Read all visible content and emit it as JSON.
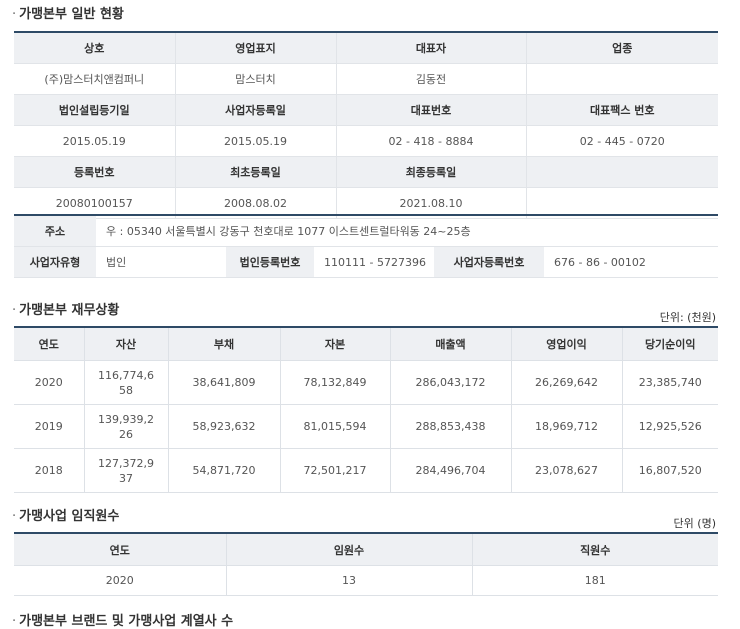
{
  "sec1": {
    "title": "가맹본부 일반 현황"
  },
  "general": {
    "row1_headers": [
      "상호",
      "영업표지",
      "대표자",
      "업종"
    ],
    "row1_values": [
      "(주)맘스터치앤컴퍼니",
      "맘스터치",
      "김동전",
      ""
    ],
    "row2_headers": [
      "법인설립등기일",
      "사업자등록일",
      "대표번호",
      "대표팩스 번호"
    ],
    "row2_values": [
      "2015.05.19",
      "2015.05.19",
      "02 - 418 - 8884",
      "02 - 445 - 0720"
    ],
    "row3_headers": [
      "등록번호",
      "최초등록일",
      "최종등록일",
      ""
    ],
    "row3_values": [
      "20080100157",
      "2008.08.02",
      "2021.08.10",
      ""
    ]
  },
  "address": {
    "label": "주소",
    "value": "우 : 05340 서울특별시 강동구 천호대로 1077 이스트센트럴타워동 24~25층",
    "biz_type_label": "사업자유형",
    "biz_type_value": "법인",
    "corp_reg_label": "법인등록번호",
    "corp_reg_value": "110111 - 5727396",
    "biz_reg_label": "사업자등록번호",
    "biz_reg_value": "676 - 86 - 00102"
  },
  "sec2": {
    "title": "가맹본부 재무상황",
    "unit": "단위: (천원)"
  },
  "finance": {
    "headers": [
      "연도",
      "자산",
      "부채",
      "자본",
      "매출액",
      "영업이익",
      "당기순이익"
    ],
    "rows": [
      [
        "2020",
        "116,774,658",
        "38,641,809",
        "78,132,849",
        "286,043,172",
        "26,269,642",
        "23,385,740"
      ],
      [
        "2019",
        "139,939,226",
        "58,923,632",
        "81,015,594",
        "288,853,438",
        "18,969,712",
        "12,925,526"
      ],
      [
        "2018",
        "127,372,937",
        "54,871,720",
        "72,501,217",
        "284,496,704",
        "23,078,627",
        "16,807,520"
      ]
    ]
  },
  "sec3": {
    "title": "가맹사업 임직원수",
    "unit": "단위 (명)"
  },
  "staff": {
    "headers": [
      "연도",
      "임원수",
      "직원수"
    ],
    "row": [
      "2020",
      "13",
      "181"
    ]
  },
  "sec4": {
    "title": "가맹본부 브랜드 및 가맹사업 계열사 수"
  }
}
